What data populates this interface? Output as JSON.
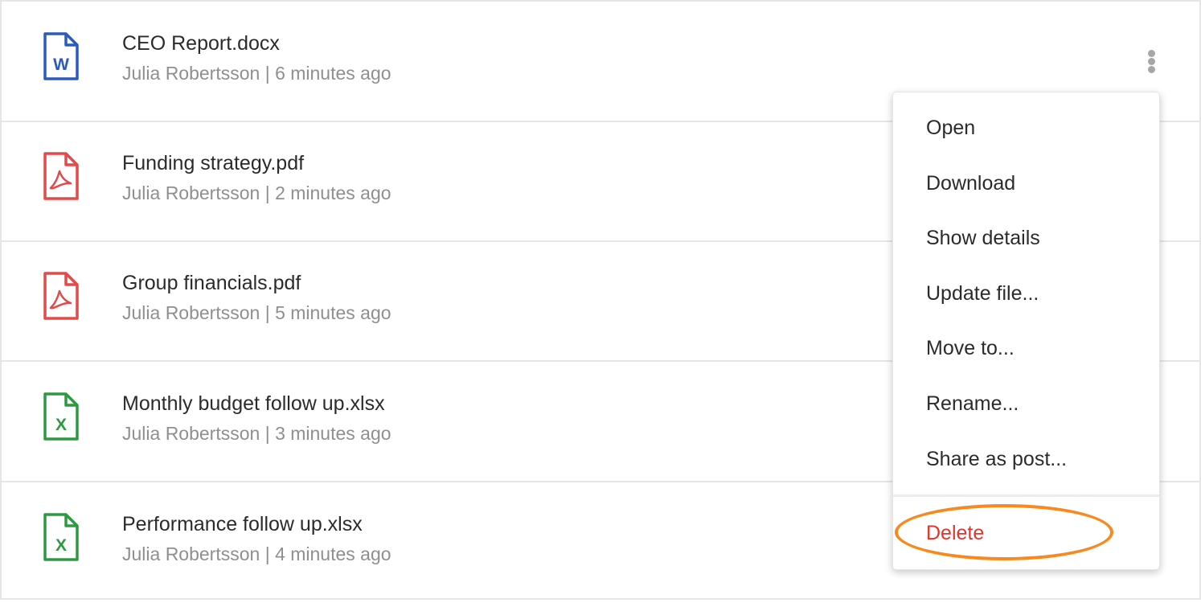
{
  "files": [
    {
      "name": "CEO Report.docx",
      "meta": "Julia Robertsson | 6 minutes ago",
      "type": "word",
      "icon": "word-file-icon",
      "letter": "W",
      "color": "#2b5cb8"
    },
    {
      "name": "Funding strategy.pdf",
      "meta": "Julia Robertsson | 2 minutes ago",
      "type": "pdf",
      "icon": "pdf-file-icon",
      "color": "#e04b4b"
    },
    {
      "name": "Group financials.pdf",
      "meta": "Julia Robertsson | 5 minutes ago",
      "type": "pdf",
      "icon": "pdf-file-icon",
      "color": "#e04b4b"
    },
    {
      "name": "Monthly budget follow up.xlsx",
      "meta": "Julia Robertsson | 3 minutes ago",
      "type": "excel",
      "icon": "excel-file-icon",
      "letter": "X",
      "color": "#2e9940"
    },
    {
      "name": "Performance follow up.xlsx",
      "meta": "Julia Robertsson | 4 minutes ago",
      "type": "excel",
      "icon": "excel-file-icon",
      "letter": "X",
      "color": "#2e9940"
    }
  ],
  "more_button": {
    "icon": "more-vertical-icon"
  },
  "menu": {
    "items": [
      "Open",
      "Download",
      "Show details",
      "Update file...",
      "Move to...",
      "Rename...",
      "Share as post..."
    ],
    "delete_label": "Delete",
    "delete_color": "#e0342c"
  },
  "annotation": {
    "color": "#f7891f",
    "target": "Delete"
  }
}
